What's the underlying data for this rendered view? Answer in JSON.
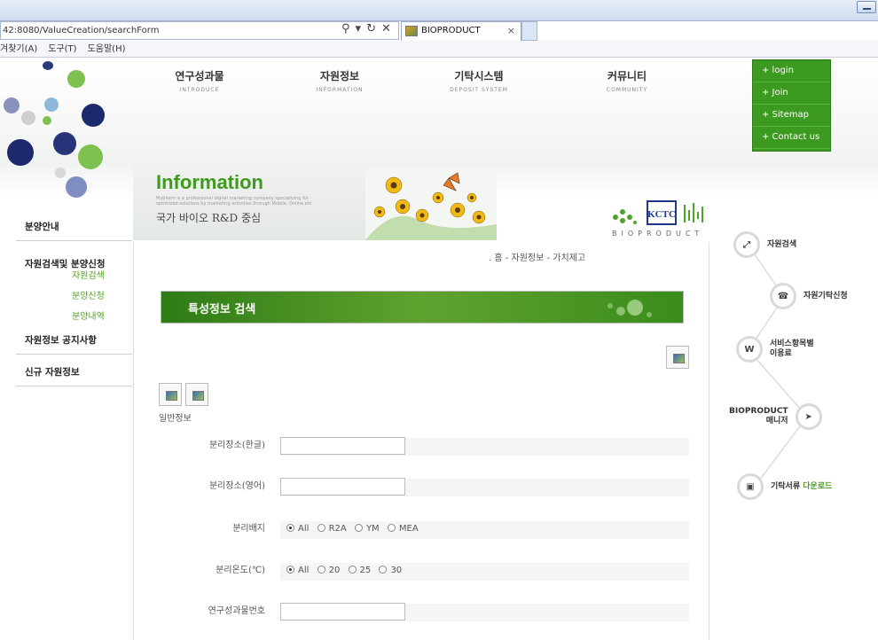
{
  "browser": {
    "address": "42:8080/ValueCreation/searchForm",
    "tab_title": "BIOPRODUCT",
    "tab_close": "×",
    "menu": [
      "겨찾기(A)",
      "도구(T)",
      "도움말(H)"
    ]
  },
  "gnb": [
    {
      "ko": "연구성과물",
      "en": "INTRODUCE"
    },
    {
      "ko": "자원정보",
      "en": "INFORMATION"
    },
    {
      "ko": "기탁시스템",
      "en": "DEPOSIT SYSTEM"
    },
    {
      "ko": "커뮤니티",
      "en": "COMMUNITY"
    }
  ],
  "util_menu": [
    "+ login",
    "+ Join",
    "+ Sitemap",
    "+ Contact us"
  ],
  "banner": {
    "title": "Information",
    "small_text": "Mybitem is a professional digital marketing company specializing for optimized solutions by marketing activities through Mobile, Online etc",
    "subtitle": "국가 바이오 R&D 중심",
    "logo_text": "KCTC",
    "bioproduct": "BIOPRODUCT"
  },
  "lnb": {
    "items": [
      "분양안내",
      "자원검색및 분양신청",
      "자원정보 공지사항",
      "신규 자원정보"
    ],
    "sub_items": [
      "자원검색",
      "분양신청",
      "분양내역"
    ]
  },
  "breadcrumb": ". 홈 - 자원정보 - 가치제고",
  "section_title": "특성정보 검색",
  "general_label": "일반정보",
  "fields": [
    {
      "label": "분리장소(한글)",
      "value": ""
    },
    {
      "label": "분리장소(영어)",
      "value": ""
    },
    {
      "label": "분리배지",
      "options": [
        "All",
        "R2A",
        "YM",
        "MEA"
      ],
      "selected": "All"
    },
    {
      "label": "분리온도(℃)",
      "options": [
        "All",
        "20",
        "25",
        "30"
      ],
      "selected": "All"
    },
    {
      "label": "연구성과물번호",
      "value": ""
    }
  ],
  "quick_menu": [
    {
      "label": "자원검색",
      "icon": "link-icon"
    },
    {
      "label": "자원기탁신청",
      "icon": "phone-icon"
    },
    {
      "label": "서비스항목별",
      "label2": "이용료",
      "icon": "won-icon",
      "glyph": "W"
    },
    {
      "label": "BIOPRODUCT",
      "label2": "매니저",
      "icon": "cursor-icon"
    },
    {
      "label": "기탁서류",
      "label_green": "다운로드",
      "icon": "briefcase-icon"
    }
  ],
  "colors": {
    "brand_green": "#3d9a20",
    "title_green": "#3f9a1d",
    "sub_green": "#52a31e"
  }
}
